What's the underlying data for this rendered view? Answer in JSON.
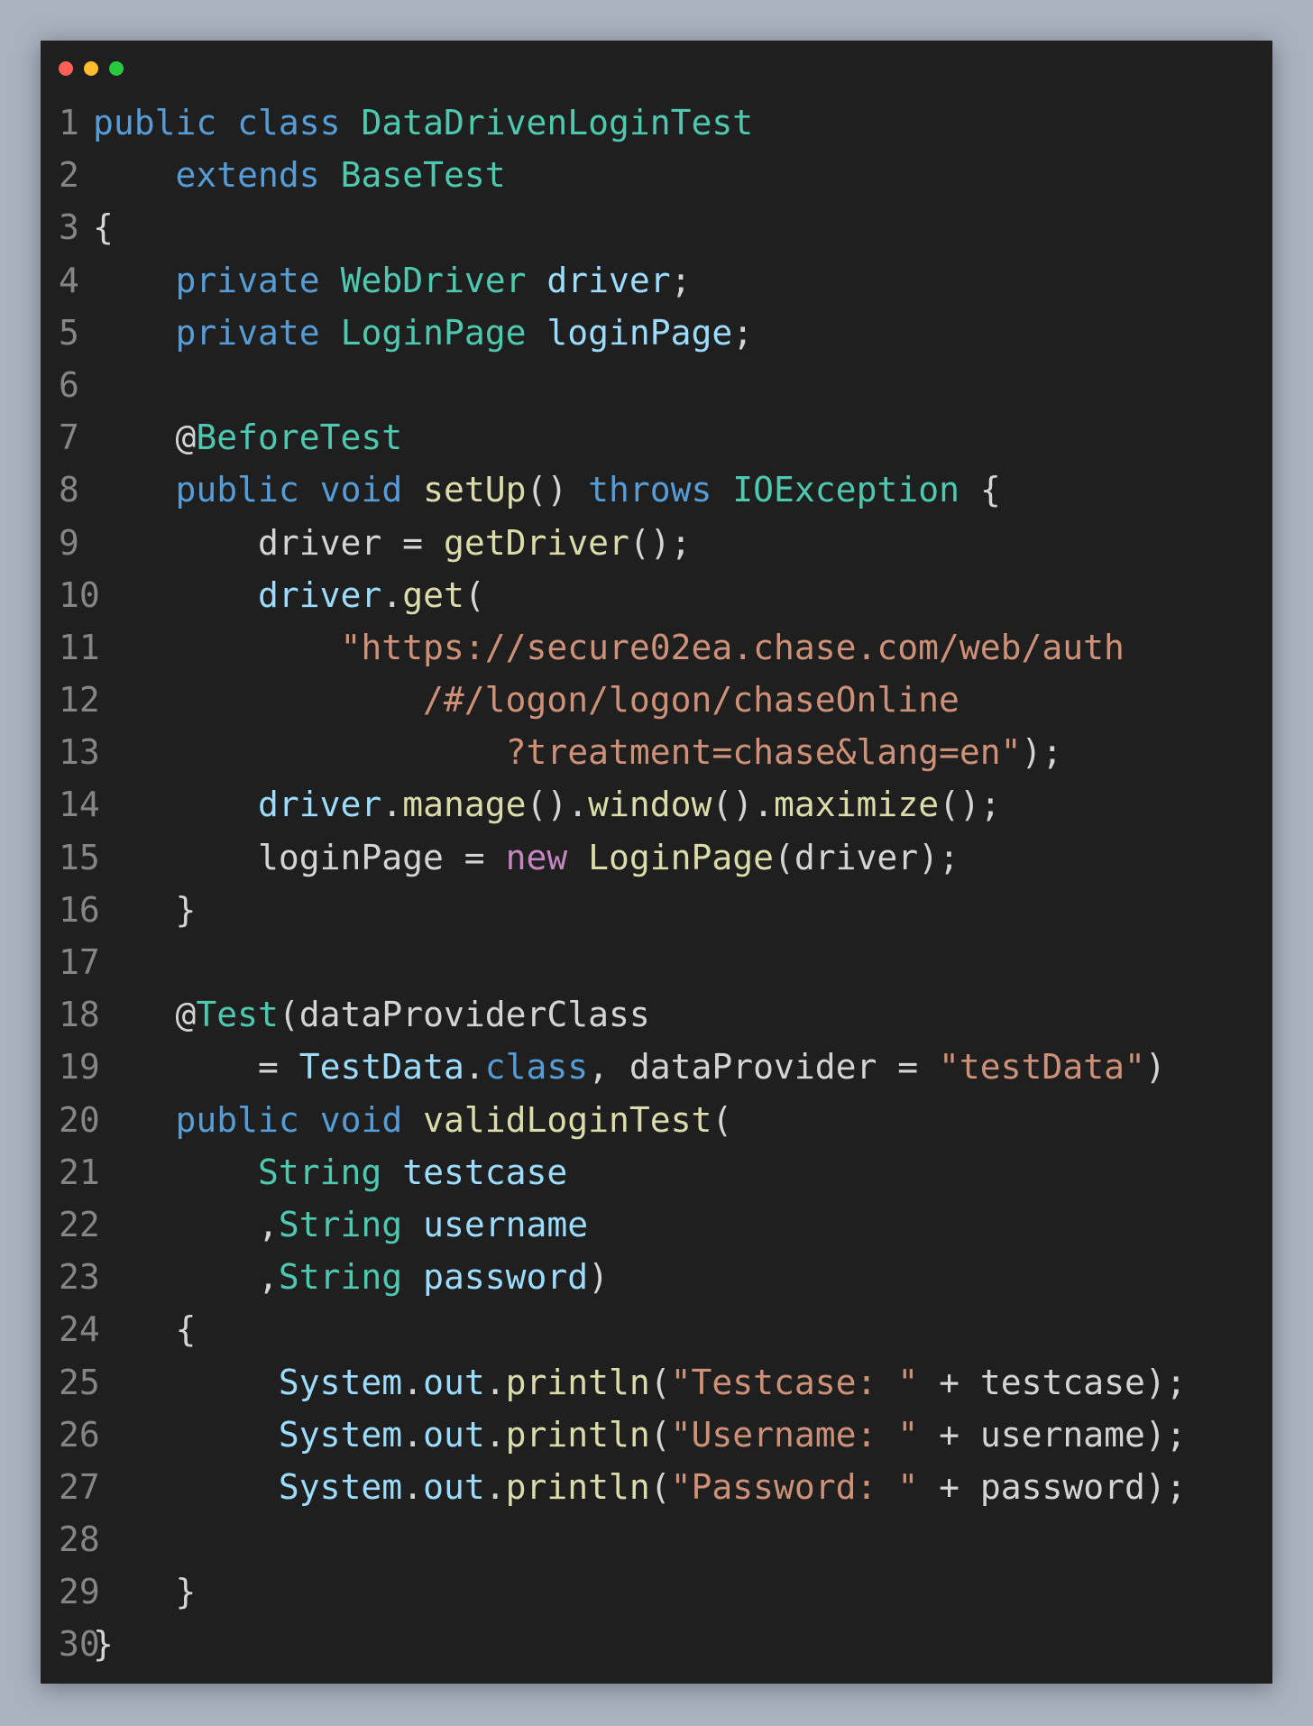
{
  "window": {
    "traffic_lights": [
      "#ff5f56",
      "#ffbd2e",
      "#27c93f"
    ]
  },
  "colors": {
    "keyword": "#569cd6",
    "type": "#4ec9b0",
    "variable": "#9cdcfe",
    "function": "#dcdcaa",
    "string": "#ce9178",
    "control": "#c586c0",
    "plain": "#d4d4d4",
    "line_number": "#858585"
  },
  "code": [
    {
      "n": "1",
      "tokens": [
        [
          "public",
          "keyword"
        ],
        [
          " ",
          "plain"
        ],
        [
          "class",
          "keyword"
        ],
        [
          " ",
          "plain"
        ],
        [
          "DataDrivenLoginTest",
          "type"
        ]
      ]
    },
    {
      "n": "2",
      "tokens": [
        [
          "    ",
          "plain"
        ],
        [
          "extends",
          "keyword"
        ],
        [
          " ",
          "plain"
        ],
        [
          "BaseTest",
          "type"
        ]
      ]
    },
    {
      "n": "3",
      "tokens": [
        [
          "{",
          "plain"
        ]
      ]
    },
    {
      "n": "4",
      "tokens": [
        [
          "    ",
          "plain"
        ],
        [
          "private",
          "keyword"
        ],
        [
          " ",
          "plain"
        ],
        [
          "WebDriver",
          "type"
        ],
        [
          " ",
          "plain"
        ],
        [
          "driver",
          "variable"
        ],
        [
          ";",
          "plain"
        ]
      ]
    },
    {
      "n": "5",
      "tokens": [
        [
          "    ",
          "plain"
        ],
        [
          "private",
          "keyword"
        ],
        [
          " ",
          "plain"
        ],
        [
          "LoginPage",
          "type"
        ],
        [
          " ",
          "plain"
        ],
        [
          "loginPage",
          "variable"
        ],
        [
          ";",
          "plain"
        ]
      ]
    },
    {
      "n": "6",
      "tokens": []
    },
    {
      "n": "7",
      "tokens": [
        [
          "    ",
          "plain"
        ],
        [
          "@",
          "plain"
        ],
        [
          "BeforeTest",
          "type"
        ]
      ]
    },
    {
      "n": "8",
      "tokens": [
        [
          "    ",
          "plain"
        ],
        [
          "public",
          "keyword"
        ],
        [
          " ",
          "plain"
        ],
        [
          "void",
          "keyword"
        ],
        [
          " ",
          "plain"
        ],
        [
          "setUp",
          "function"
        ],
        [
          "() ",
          "plain"
        ],
        [
          "throws",
          "keyword"
        ],
        [
          " ",
          "plain"
        ],
        [
          "IOException",
          "type"
        ],
        [
          " {",
          "plain"
        ]
      ]
    },
    {
      "n": "9",
      "tokens": [
        [
          "        ",
          "plain"
        ],
        [
          "driver = ",
          "plain"
        ],
        [
          "getDriver",
          "function"
        ],
        [
          "();",
          "plain"
        ]
      ]
    },
    {
      "n": "10",
      "tokens": [
        [
          "        ",
          "plain"
        ],
        [
          "driver",
          "variable"
        ],
        [
          ".",
          "plain"
        ],
        [
          "get",
          "function"
        ],
        [
          "(",
          "plain"
        ]
      ]
    },
    {
      "n": "11",
      "tokens": [
        [
          "            ",
          "plain"
        ],
        [
          "\"https://secure02ea.chase.com/web/auth",
          "string"
        ]
      ]
    },
    {
      "n": "12",
      "tokens": [
        [
          "                ",
          "plain"
        ],
        [
          "/#/logon/logon/chaseOnline",
          "string"
        ]
      ]
    },
    {
      "n": "13",
      "tokens": [
        [
          "                    ",
          "plain"
        ],
        [
          "?treatment=chase&lang=en\"",
          "string"
        ],
        [
          ");",
          "plain"
        ]
      ]
    },
    {
      "n": "14",
      "tokens": [
        [
          "        ",
          "plain"
        ],
        [
          "driver",
          "variable"
        ],
        [
          ".",
          "plain"
        ],
        [
          "manage",
          "function"
        ],
        [
          "().",
          "plain"
        ],
        [
          "window",
          "function"
        ],
        [
          "().",
          "plain"
        ],
        [
          "maximize",
          "function"
        ],
        [
          "();",
          "plain"
        ]
      ]
    },
    {
      "n": "15",
      "tokens": [
        [
          "        ",
          "plain"
        ],
        [
          "loginPage = ",
          "plain"
        ],
        [
          "new",
          "control"
        ],
        [
          " ",
          "plain"
        ],
        [
          "LoginPage",
          "function"
        ],
        [
          "(driver);",
          "plain"
        ]
      ]
    },
    {
      "n": "16",
      "tokens": [
        [
          "    ",
          "plain"
        ],
        [
          "}",
          "plain"
        ]
      ]
    },
    {
      "n": "17",
      "tokens": []
    },
    {
      "n": "18",
      "tokens": [
        [
          "    ",
          "plain"
        ],
        [
          "@",
          "plain"
        ],
        [
          "Test",
          "type"
        ],
        [
          "(dataProviderClass",
          "plain"
        ]
      ]
    },
    {
      "n": "19",
      "tokens": [
        [
          "        ",
          "plain"
        ],
        [
          "= ",
          "plain"
        ],
        [
          "TestData",
          "variable"
        ],
        [
          ".",
          "plain"
        ],
        [
          "class",
          "keyword"
        ],
        [
          ", dataProvider = ",
          "plain"
        ],
        [
          "\"testData\"",
          "string"
        ],
        [
          ")",
          "plain"
        ]
      ]
    },
    {
      "n": "20",
      "tokens": [
        [
          "    ",
          "plain"
        ],
        [
          "public",
          "keyword"
        ],
        [
          " ",
          "plain"
        ],
        [
          "void",
          "keyword"
        ],
        [
          " ",
          "plain"
        ],
        [
          "validLoginTest",
          "function"
        ],
        [
          "(",
          "plain"
        ]
      ]
    },
    {
      "n": "21",
      "tokens": [
        [
          "        ",
          "plain"
        ],
        [
          "String",
          "type"
        ],
        [
          " ",
          "plain"
        ],
        [
          "testcase",
          "variable"
        ]
      ]
    },
    {
      "n": "22",
      "tokens": [
        [
          "        ",
          "plain"
        ],
        [
          ",",
          "plain"
        ],
        [
          "String",
          "type"
        ],
        [
          " ",
          "plain"
        ],
        [
          "username",
          "variable"
        ]
      ]
    },
    {
      "n": "23",
      "tokens": [
        [
          "        ",
          "plain"
        ],
        [
          ",",
          "plain"
        ],
        [
          "String",
          "type"
        ],
        [
          " ",
          "plain"
        ],
        [
          "password",
          "variable"
        ],
        [
          ")",
          "plain"
        ]
      ]
    },
    {
      "n": "24",
      "tokens": [
        [
          "    ",
          "plain"
        ],
        [
          "{",
          "plain"
        ]
      ]
    },
    {
      "n": "25",
      "tokens": [
        [
          "         ",
          "plain"
        ],
        [
          "System",
          "variable"
        ],
        [
          ".",
          "plain"
        ],
        [
          "out",
          "variable"
        ],
        [
          ".",
          "plain"
        ],
        [
          "println",
          "function"
        ],
        [
          "(",
          "plain"
        ],
        [
          "\"Testcase: \"",
          "string"
        ],
        [
          " + testcase);",
          "plain"
        ]
      ]
    },
    {
      "n": "26",
      "tokens": [
        [
          "         ",
          "plain"
        ],
        [
          "System",
          "variable"
        ],
        [
          ".",
          "plain"
        ],
        [
          "out",
          "variable"
        ],
        [
          ".",
          "plain"
        ],
        [
          "println",
          "function"
        ],
        [
          "(",
          "plain"
        ],
        [
          "\"Username: \"",
          "string"
        ],
        [
          " + username);",
          "plain"
        ]
      ]
    },
    {
      "n": "27",
      "tokens": [
        [
          "         ",
          "plain"
        ],
        [
          "System",
          "variable"
        ],
        [
          ".",
          "plain"
        ],
        [
          "out",
          "variable"
        ],
        [
          ".",
          "plain"
        ],
        [
          "println",
          "function"
        ],
        [
          "(",
          "plain"
        ],
        [
          "\"Password: \"",
          "string"
        ],
        [
          " + password);",
          "plain"
        ]
      ]
    },
    {
      "n": "28",
      "tokens": []
    },
    {
      "n": "29",
      "tokens": [
        [
          "    ",
          "plain"
        ],
        [
          "}",
          "plain"
        ]
      ]
    },
    {
      "n": "30",
      "tokens": [
        [
          "}",
          "plain"
        ]
      ]
    }
  ]
}
